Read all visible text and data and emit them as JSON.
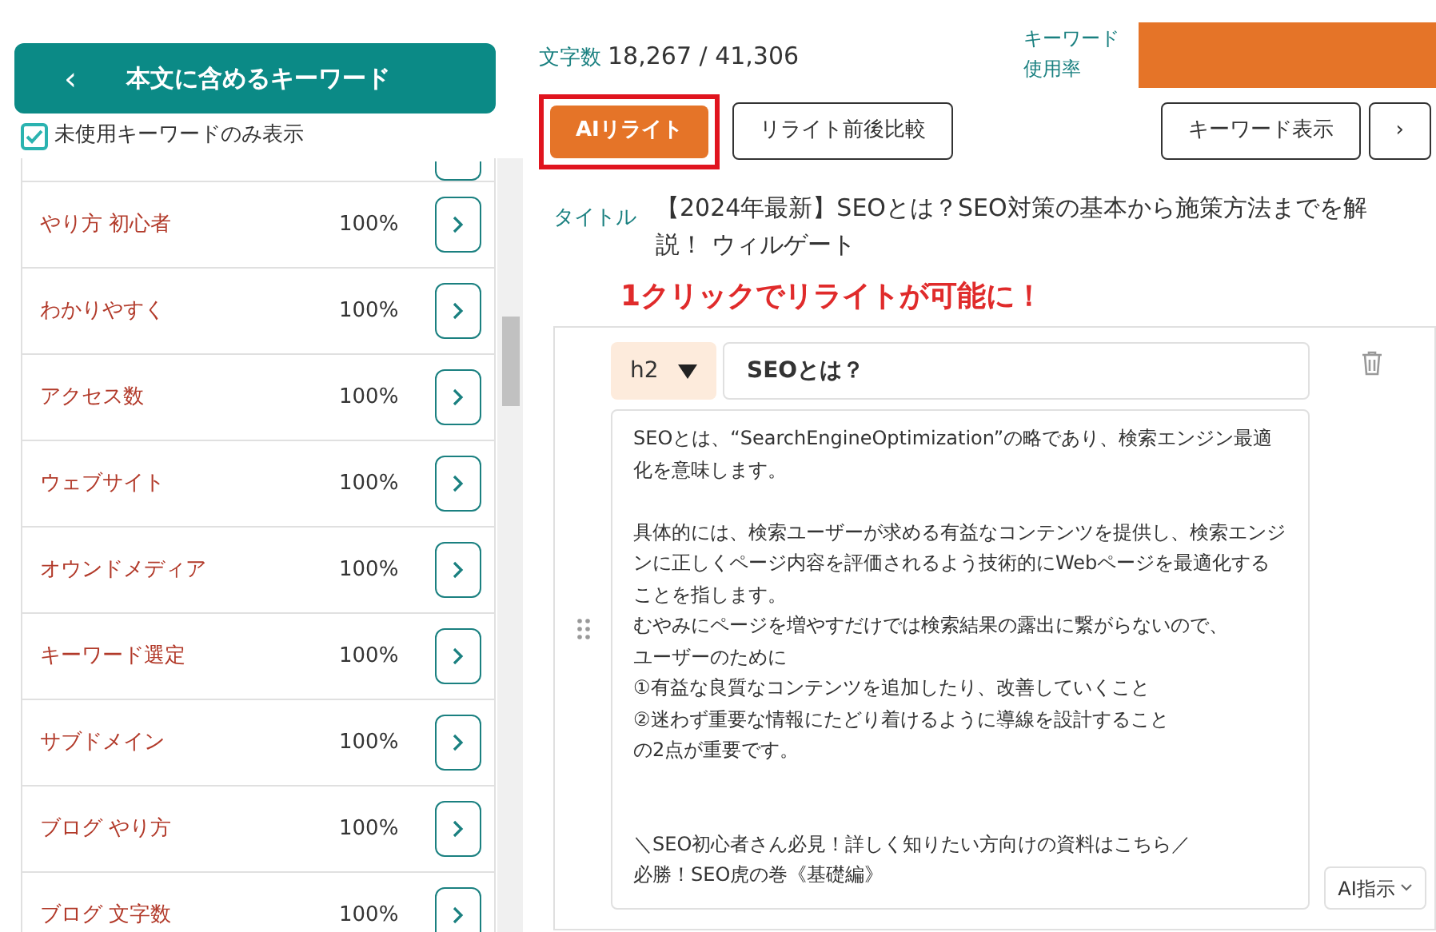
{
  "sidebar": {
    "title": "本文に含めるキーワード",
    "back": "‹",
    "filter": {
      "label": "未使用キーワードのみ表示",
      "checked": true
    },
    "keywords": [
      {
        "kind": "clipped"
      },
      {
        "label": "やり方 初心者",
        "percent": "100%"
      },
      {
        "label": "わかりやすく",
        "percent": "100%"
      },
      {
        "label": "アクセス数",
        "percent": "100%"
      },
      {
        "label": "ウェブサイト",
        "percent": "100%"
      },
      {
        "label": "オウンドメディア",
        "percent": "100%"
      },
      {
        "label": "キーワード選定",
        "percent": "100%"
      },
      {
        "label": "サブドメイン",
        "percent": "100%"
      },
      {
        "label": "ブログ やり方",
        "percent": "100%"
      },
      {
        "label": "ブログ 文字数",
        "percent": "100%"
      }
    ]
  },
  "stats": {
    "char_label": "文字数",
    "char_count": "18,267 / 41,306",
    "usage_label": "キーワード使用率"
  },
  "toolbar": {
    "left": [
      {
        "label": "AIリライト",
        "kind": "primary"
      },
      {
        "label": "リライト前後比較",
        "kind": "outline"
      }
    ],
    "right": [
      {
        "label": "キーワード表示",
        "kind": "outline"
      },
      {
        "label": "›",
        "kind": "outline"
      }
    ]
  },
  "title": {
    "label": "タイトル",
    "value": "【2024年最新】SEOとは？SEO対策の基本から施策方法までを解説！ ウィルゲート"
  },
  "annotation": "1クリックでリライトが可能に！",
  "section": {
    "level": "h2",
    "heading": "SEOとは？",
    "body": [
      {
        "kind": "line",
        "text": "SEOとは、“SearchEngineOptimization”の略であり、検索エンジン最適化を意味します。"
      },
      {
        "kind": "para",
        "text": "具体的には、検索ユーザーが求める有益なコンテンツを提供し、検索エンジンに正しくページ内容を評価されるよう技術的にWebページを最適化することを指します。"
      },
      {
        "kind": "line",
        "text": "むやみにページを増やすだけでは検索結果の露出に繋がらないので、"
      },
      {
        "kind": "line",
        "text": "ユーザーのために"
      },
      {
        "kind": "line",
        "text": "①有益な良質なコンテンツを追加したり、改善していくこと"
      },
      {
        "kind": "line",
        "text": "②迷わず重要な情報にたどり着けるように導線を設計すること"
      },
      {
        "kind": "line",
        "text": "の2点が重要です。"
      },
      {
        "kind": "gap",
        "text": "＼SEO初心者さん必見！詳しく知りたい方向けの資料はこちら／"
      },
      {
        "kind": "line",
        "text": "必勝！SEO虎の巻《基礎編》"
      }
    ],
    "ai_button": "AI指示"
  }
}
